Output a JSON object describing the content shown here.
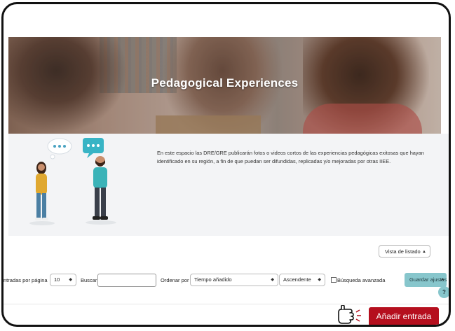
{
  "hero": {
    "title": "Pedagogical Experiences"
  },
  "info": {
    "description": "En este espacio las DRE/GRE publicarán fotos o videos cortos de las experiencias pedagógicas exitosas que hayan identificado en su región, a fin de que puedan ser difundidas, replicadas y/o mejoradas por otras IIEE."
  },
  "view": {
    "mode_label": "Vista de listado"
  },
  "filters": {
    "per_page_label": "ntradas por página",
    "per_page_value": "10",
    "search_label": "Buscar",
    "search_value": "",
    "sort_label": "Ordenar por",
    "sort_value": "Tiempo añadido",
    "order_value": "Ascendente",
    "advanced_label": "Búsqueda avanzada",
    "save_label": "Guardar ajustes"
  },
  "actions": {
    "add_entry_label": "Añadir entrada",
    "help_label": "?"
  },
  "colors": {
    "accent_teal": "#87c6cc",
    "primary_red": "#b50f1e",
    "panel_bg": "#f3f4f6"
  },
  "icons": [
    "chevron-up-icon",
    "help-icon",
    "pointing-hand-icon",
    "speech-bubble-icon"
  ]
}
